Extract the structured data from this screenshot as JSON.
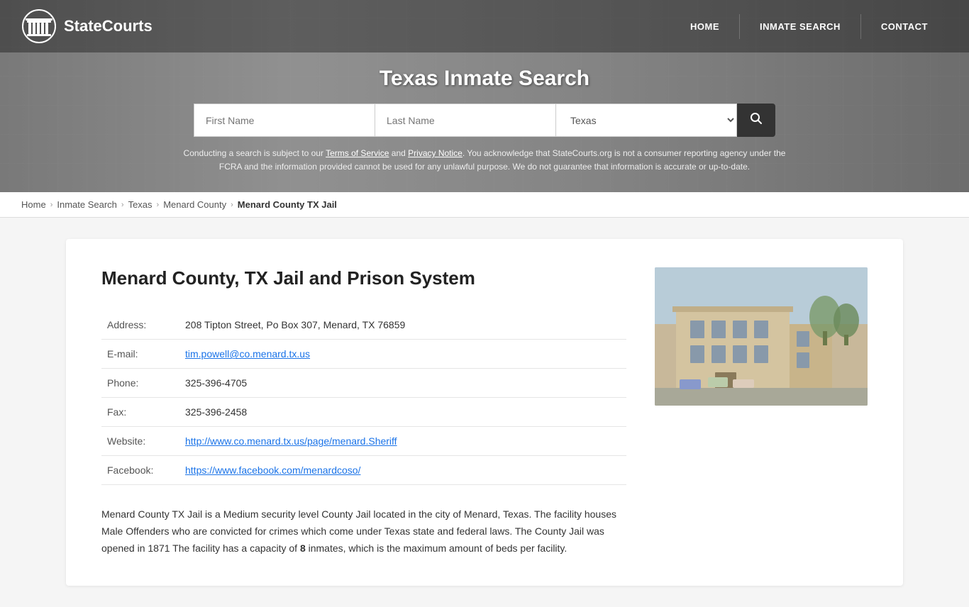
{
  "site": {
    "name": "StateCourts",
    "logo_alt": "StateCourts logo"
  },
  "nav": {
    "home_label": "HOME",
    "inmate_search_label": "INMATE SEARCH",
    "contact_label": "CONTACT"
  },
  "hero": {
    "title": "Texas Inmate Search",
    "first_name_placeholder": "First Name",
    "last_name_placeholder": "Last Name",
    "state_select_label": "Select State",
    "search_button_label": "🔍"
  },
  "disclaimer": {
    "text_before_terms": "Conducting a search is subject to our ",
    "terms_label": "Terms of Service",
    "text_between": " and ",
    "privacy_label": "Privacy Notice",
    "text_after": ". You acknowledge that StateCourts.org is not a consumer reporting agency under the FCRA and the information provided cannot be used for any unlawful purpose. We do not guarantee that information is accurate or up-to-date."
  },
  "breadcrumb": {
    "home": "Home",
    "inmate_search": "Inmate Search",
    "state": "Texas",
    "county": "Menard County",
    "current": "Menard County TX Jail"
  },
  "page": {
    "title": "Menard County, TX Jail and Prison System",
    "address_label": "Address:",
    "address_value": "208 Tipton Street, Po Box 307, Menard, TX 76859",
    "email_label": "E-mail:",
    "email_value": "tim.powell@co.menard.tx.us",
    "email_href": "mailto:tim.powell@co.menard.tx.us",
    "phone_label": "Phone:",
    "phone_value": "325-396-4705",
    "fax_label": "Fax:",
    "fax_value": "325-396-2458",
    "website_label": "Website:",
    "website_value": "http://www.co.menard.tx.us/page/menard.Sheriff",
    "facebook_label": "Facebook:",
    "facebook_value": "https://www.facebook.com/menardcoso/",
    "description": "Menard County TX Jail is a Medium security level County Jail located in the city of Menard, Texas. The facility houses Male Offenders who are convicted for crimes which come under Texas state and federal laws. The County Jail was opened in 1871 The facility has a capacity of ",
    "capacity": "8",
    "description_end": " inmates, which is the maximum amount of beds per facility."
  }
}
